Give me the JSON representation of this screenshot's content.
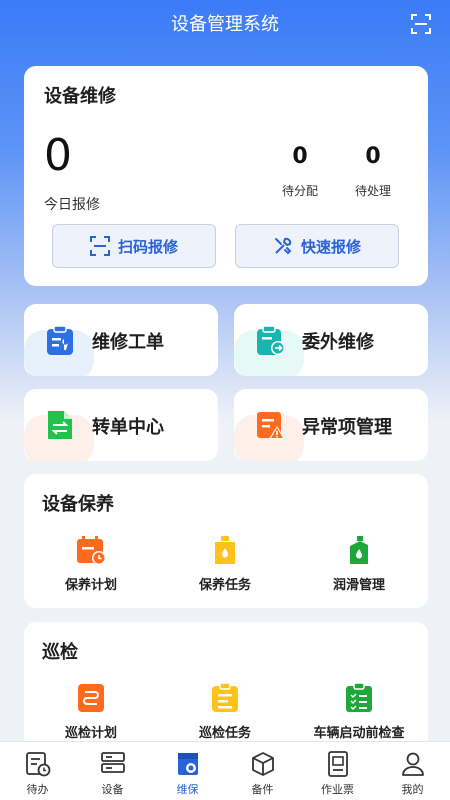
{
  "header": {
    "title": "设备管理系统",
    "scan_icon": "scan-frame-icon"
  },
  "repair": {
    "title": "设备维修",
    "today_count": "0",
    "today_label": "今日报修",
    "pending_assign_count": "0",
    "pending_assign_label": "待分配",
    "pending_process_count": "0",
    "pending_process_label": "待处理",
    "scan_button": "扫码报修",
    "quick_button": "快速报修"
  },
  "tiles": [
    {
      "label": "维修工单",
      "icon": "clipboard-wrench-icon",
      "color": "#2f6fe4"
    },
    {
      "label": "委外维修",
      "icon": "clipboard-forward-icon",
      "color": "#19b5b0"
    },
    {
      "label": "转单中心",
      "icon": "document-transfer-icon",
      "color": "#1fc24a"
    },
    {
      "label": "异常项管理",
      "icon": "document-warning-icon",
      "color": "#ff6a1f"
    }
  ],
  "maintenance": {
    "title": "设备保养",
    "items": [
      {
        "label": "保养计划",
        "icon": "calendar-clock-icon",
        "color": "#ff6a1f"
      },
      {
        "label": "保养任务",
        "icon": "oil-can-icon",
        "color": "#ffc21a"
      },
      {
        "label": "润滑管理",
        "icon": "oil-drop-icon",
        "color": "#1fa83a"
      }
    ]
  },
  "inspection": {
    "title": "巡检",
    "items": [
      {
        "label": "巡检计划",
        "icon": "route-plan-icon",
        "color": "#ff6a1f"
      },
      {
        "label": "巡检任务",
        "icon": "task-list-icon",
        "color": "#ffc21a"
      },
      {
        "label": "车辆启动前检查",
        "icon": "checklist-icon",
        "color": "#1fa83a"
      }
    ]
  },
  "nav": [
    {
      "label": "待办",
      "icon": "todo-clock-icon"
    },
    {
      "label": "设备",
      "icon": "device-server-icon"
    },
    {
      "label": "维保",
      "icon": "maintenance-icon"
    },
    {
      "label": "备件",
      "icon": "box-icon"
    },
    {
      "label": "作业票",
      "icon": "ticket-icon"
    },
    {
      "label": "我的",
      "icon": "person-icon"
    }
  ],
  "active_nav": "维保",
  "accent_color": "#2a62d9"
}
